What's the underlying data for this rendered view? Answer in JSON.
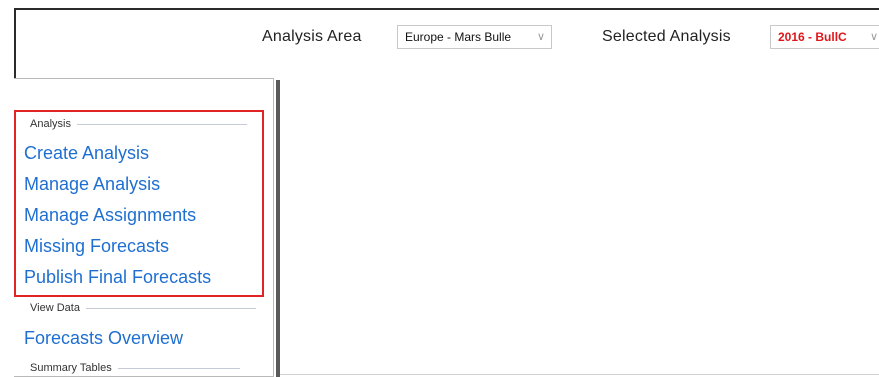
{
  "header": {
    "analysis_area_label": "Analysis Area",
    "analysis_area_value": "Europe - Mars Bulle",
    "selected_analysis_label": "Selected Analysis",
    "selected_analysis_value": "2016 - BullC"
  },
  "sidebar": {
    "sections": [
      {
        "title": "Analysis",
        "items": [
          {
            "label": "Create Analysis"
          },
          {
            "label": "Manage Analysis"
          },
          {
            "label": "Manage Assignments"
          },
          {
            "label": "Missing Forecasts"
          },
          {
            "label": "Publish Final Forecasts"
          }
        ]
      },
      {
        "title": "View Data",
        "items": [
          {
            "label": "Forecasts Overview"
          }
        ]
      },
      {
        "title": "Summary Tables",
        "items": []
      }
    ]
  },
  "colors": {
    "link": "#1f6fd1",
    "highlight_border": "#e02424",
    "selected_analysis_text": "#e0161b"
  },
  "icons": {
    "dropdown_chevron": "chevron-down-icon"
  }
}
